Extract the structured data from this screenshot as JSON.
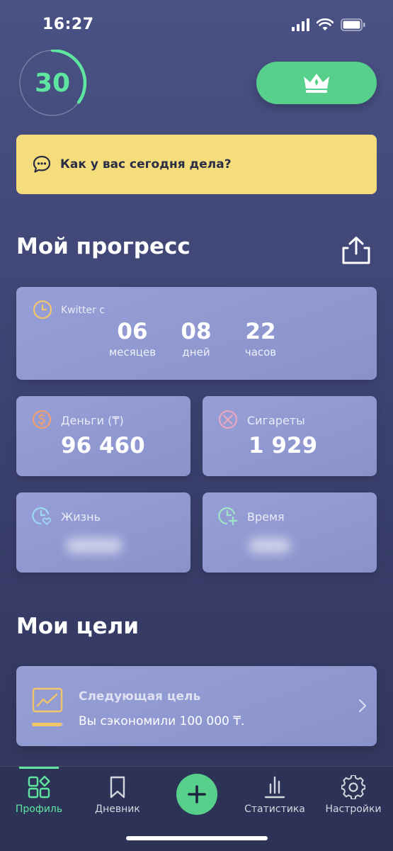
{
  "status": {
    "time": "16:27"
  },
  "streak": {
    "value": "30",
    "progress": 0.35,
    "color": "#5ee6a0"
  },
  "premium": {
    "icon": "crown-icon"
  },
  "mood": {
    "question": "Как у вас сегодня дела?",
    "icon": "chat-bubble-icon"
  },
  "progress": {
    "title": "Мой прогресс",
    "quit_since": {
      "label": "Kwitter с",
      "icon": "clock-icon",
      "items": [
        {
          "value": "06",
          "unit": "месяцев"
        },
        {
          "value": "08",
          "unit": "дней"
        },
        {
          "value": "22",
          "unit": "часов"
        }
      ]
    },
    "money": {
      "label": "Деньги (₸)",
      "value": "96 460",
      "icon": "coin-icon"
    },
    "cigarettes": {
      "label": "Сигареты",
      "value": "1 929",
      "icon": "no-cigarette-icon"
    },
    "life": {
      "label": "Жизнь",
      "icon": "clock-heart-icon"
    },
    "time_saved": {
      "label": "Время",
      "icon": "clock-plus-icon"
    }
  },
  "goals": {
    "title": "Мои цели",
    "next_goal": {
      "title": "Следующая цель",
      "description": "Вы сэкономили 100 000 ₸.",
      "icon": "chart-trend-icon",
      "progress": 0.96
    }
  },
  "tabbar": {
    "tabs": [
      {
        "label": "Профиль",
        "icon": "grid-icon",
        "active": true
      },
      {
        "label": "Дневник",
        "icon": "bookmark-icon",
        "active": false
      },
      {
        "label": "Статистика",
        "icon": "bar-chart-icon",
        "active": false
      },
      {
        "label": "Настройки",
        "icon": "gear-icon",
        "active": false
      }
    ],
    "add_icon": "plus-icon"
  },
  "colors": {
    "accent": "#57d08b",
    "mood_card": "#f6dd7c",
    "card": "#8f97d0"
  }
}
